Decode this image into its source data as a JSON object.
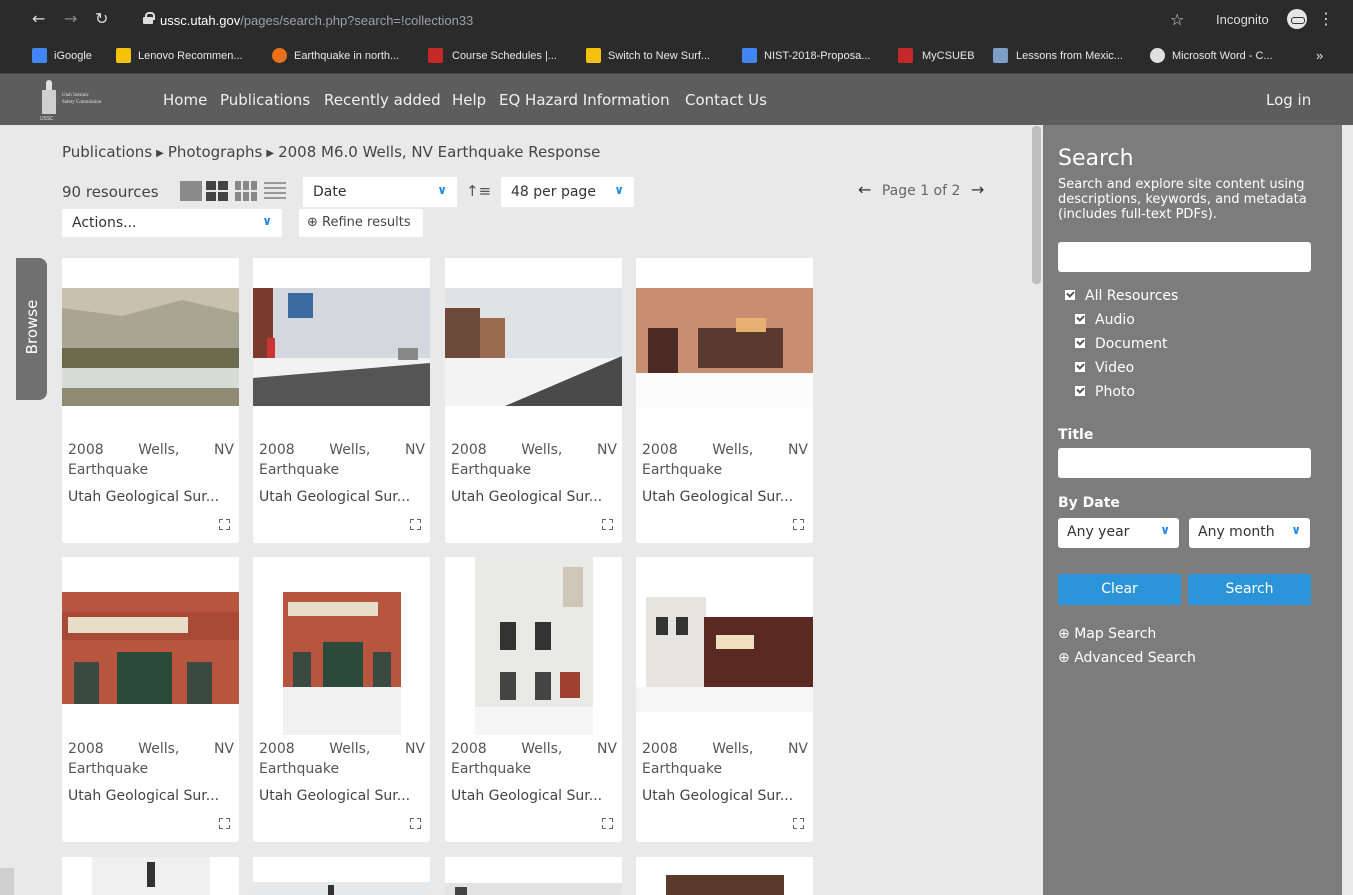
{
  "browser": {
    "url_host": "ussc.utah.gov",
    "url_path": "/pages/search.php?search=!collection33",
    "incognito_label": "Incognito",
    "bookmarks": [
      {
        "label": "iGoogle",
        "color": "#4285f4"
      },
      {
        "label": "Lenovo Recommen...",
        "color": "#f4c20d"
      },
      {
        "label": "Earthquake in north...",
        "color": "#e8711a"
      },
      {
        "label": "Course Schedules |...",
        "color": "#c62828"
      },
      {
        "label": "Switch to New Surf...",
        "color": "#f4c20d"
      },
      {
        "label": "NIST-2018-Proposa...",
        "color": "#4285f4"
      },
      {
        "label": "MyCSUEB",
        "color": "#c62828"
      },
      {
        "label": "Lessons from Mexic...",
        "color": "#7e9fc5"
      },
      {
        "label": "Microsoft Word - C...",
        "color": "#e0e0e0"
      }
    ],
    "more": "»"
  },
  "site": {
    "logo_text": [
      "Utah Seismic",
      "Safety Commission"
    ],
    "logo_abbr": "USSC",
    "nav": [
      "Home",
      "Publications",
      "Recently added",
      "Help",
      "EQ Hazard Information",
      "Contact Us"
    ],
    "login": "Log in",
    "browse_tab": "Browse"
  },
  "breadcrumb": [
    "Publications",
    "Photographs",
    "2008 M6.0 Wells, NV Earthquake Response"
  ],
  "toolbar": {
    "resource_count": "90 resources",
    "sort_select": "Date",
    "per_page_select": "48 per page",
    "actions_select": "Actions...",
    "refine_button": "Refine results",
    "pager_text": "Page 1 of 2"
  },
  "cards": [
    {
      "title_line1": [
        "2008",
        "Wells,",
        "NV"
      ],
      "title_line2": "Earthquake",
      "source": "Utah Geological Sur..."
    },
    {
      "title_line1": [
        "2008",
        "Wells,",
        "NV"
      ],
      "title_line2": "Earthquake",
      "source": "Utah Geological Sur..."
    },
    {
      "title_line1": [
        "2008",
        "Wells,",
        "NV"
      ],
      "title_line2": "Earthquake",
      "source": "Utah Geological Sur..."
    },
    {
      "title_line1": [
        "2008",
        "Wells,",
        "NV"
      ],
      "title_line2": "Earthquake",
      "source": "Utah Geological Sur..."
    },
    {
      "title_line1": [
        "2008",
        "Wells,",
        "NV"
      ],
      "title_line2": "Earthquake",
      "source": "Utah Geological Sur..."
    },
    {
      "title_line1": [
        "2008",
        "Wells,",
        "NV"
      ],
      "title_line2": "Earthquake",
      "source": "Utah Geological Sur..."
    },
    {
      "title_line1": [
        "2008",
        "Wells,",
        "NV"
      ],
      "title_line2": "Earthquake",
      "source": "Utah Geological Sur..."
    },
    {
      "title_line1": [
        "2008",
        "Wells,",
        "NV"
      ],
      "title_line2": "Earthquake",
      "source": "Utah Geological Sur..."
    }
  ],
  "search_panel": {
    "heading": "Search",
    "description": "Search and explore site content using descriptions, keywords, and metadata (includes full-text PDFs).",
    "search_input_value": "",
    "resource_types": {
      "all": "All Resources",
      "audio": "Audio",
      "document": "Document",
      "video": "Video",
      "photo": "Photo"
    },
    "title_label": "Title",
    "title_input_value": "",
    "date_label": "By Date",
    "year_select": "Any year",
    "month_select": "Any month",
    "clear_button": "Clear",
    "search_button": "Search",
    "map_search_link": "Map Search",
    "advanced_search_link": "Advanced Search"
  },
  "colors": {
    "header_bg": "#5d5d5d",
    "panel_bg": "#7c7c7c",
    "accent": "#2b94d9",
    "chevron": "#1e88e5"
  }
}
